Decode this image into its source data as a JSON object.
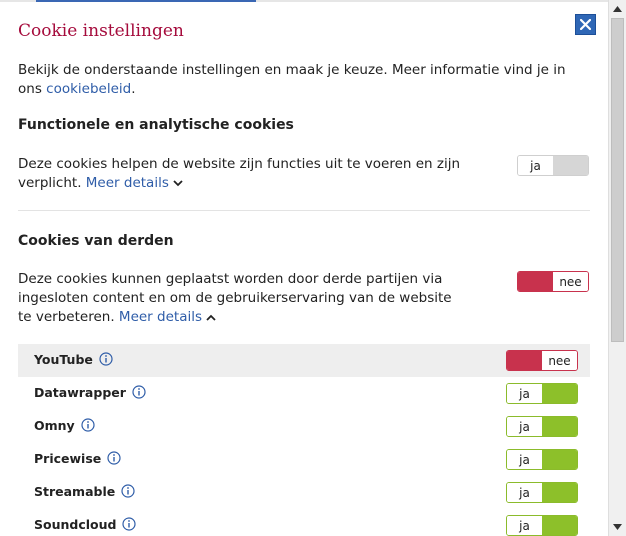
{
  "dialog": {
    "title": "Cookie instellingen",
    "intro_text": "Bekijk de onderstaande instellingen en maak je keuze. Meer informatie vind je in ons ",
    "intro_link": "cookiebeleid",
    "intro_end": ".",
    "close_icon": "close-icon"
  },
  "functional": {
    "heading": "Functionele en analytische cookies",
    "description": "Deze cookies helpen de website zijn functies uit te voeren en zijn verplicht.",
    "details_label": "Meer details",
    "toggle_label": "ja"
  },
  "third_party": {
    "heading": "Cookies van derden",
    "description": "Deze cookies kunnen geplaatst worden door derde partijen via ingesloten content en om de gebruikerservaring van de website te verbeteren.",
    "details_label": "Meer details",
    "toggle_label": "nee",
    "providers": [
      {
        "name": "YouTube",
        "toggle": "nee"
      },
      {
        "name": "Datawrapper",
        "toggle": "ja"
      },
      {
        "name": "Omny",
        "toggle": "ja"
      },
      {
        "name": "Pricewise",
        "toggle": "ja"
      },
      {
        "name": "Streamable",
        "toggle": "ja"
      },
      {
        "name": "Soundcloud",
        "toggle": "ja"
      }
    ]
  },
  "colors": {
    "title": "#a50b3c",
    "link": "#2f5da8",
    "off": "#c8324d",
    "on": "#8dc02a",
    "locked": "#d6d6d6"
  }
}
